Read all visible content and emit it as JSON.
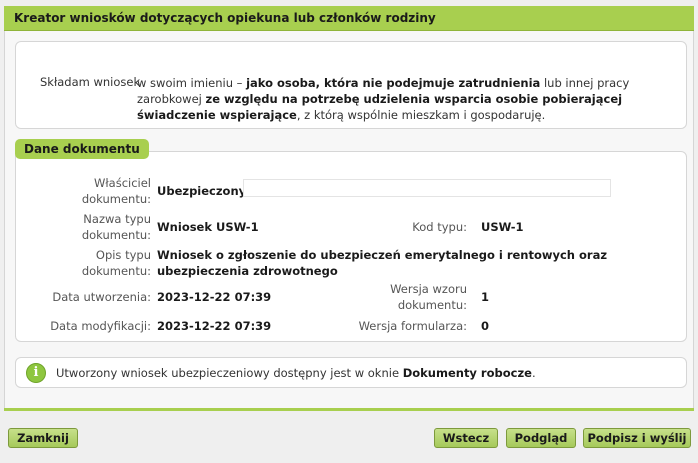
{
  "window": {
    "title": "Kreator wniosków dotyczących opiekuna lub członków rodziny"
  },
  "declaration": {
    "label": "Składam wniosek",
    "text_parts": [
      {
        "text": "w swoim imieniu – ",
        "bold": false
      },
      {
        "text": "jako osoba, która nie podejmuje zatrudnienia",
        "bold": true
      },
      {
        "text": " lub innej pracy zarobkowej ",
        "bold": false
      },
      {
        "text": "ze względu na potrzebę udzielenia wsparcia osobie pobierającej świadczenie wspierające",
        "bold": true
      },
      {
        "text": ", z którą wspólnie mieszkam i gospodaruję.",
        "bold": false
      }
    ]
  },
  "document": {
    "section_title": "Dane dokumentu",
    "owner_label": "Właściciel dokumentu:",
    "owner_value": "Ubezpieczony",
    "type_name_label": "Nazwa typu dokumentu:",
    "type_name_value": "Wniosek USW-1",
    "type_code_label": "Kod typu:",
    "type_code_value": "USW-1",
    "type_desc_label": "Opis typu dokumentu:",
    "type_desc_value": "Wniosek o zgłoszenie do ubezpieczeń emerytalnego i rentowych oraz ubezpieczenia zdrowotnego",
    "created_label": "Data utworzenia:",
    "created_value": "2023-12-22 07:39",
    "template_version_label": "Wersja wzoru dokumentu:",
    "template_version_value": "1",
    "modified_label": "Data modyfikacji:",
    "modified_value": "2023-12-22 07:39",
    "form_version_label": "Wersja formularza:",
    "form_version_value": "0"
  },
  "info": {
    "icon": "info-icon",
    "text_before": "Utworzony wniosek ubezpieczeniowy dostępny jest w oknie ",
    "text_bold": "Dokumenty robocze",
    "text_after": "."
  },
  "buttons": {
    "close": "Zamknij",
    "back": "Wstecz",
    "preview": "Podgląd",
    "sign_send": "Podpisz i wyślij"
  },
  "colors": {
    "accent": "#a8cf4f",
    "button": "#b5d472",
    "info_icon": "#8ec63f"
  }
}
